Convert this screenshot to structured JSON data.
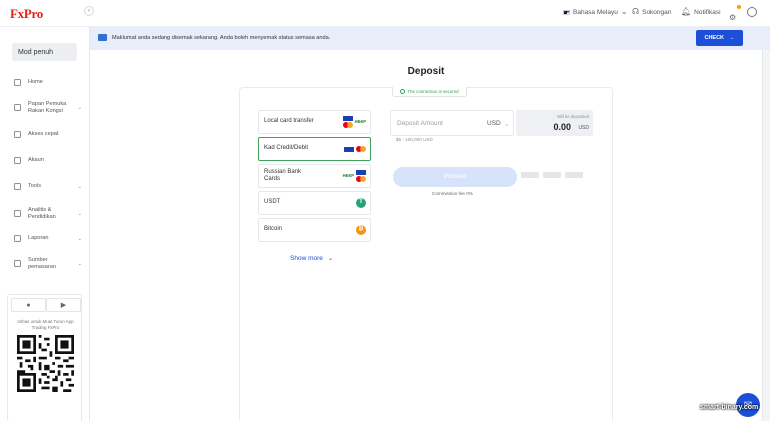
{
  "app": {
    "logo": "FxPro"
  },
  "topbar": {
    "language": "Bahasa Melayu",
    "support": "Sokongan",
    "notifications": "Notifikasi"
  },
  "sidebar": {
    "mode_button": "Mod penuh",
    "items": [
      {
        "label": "Home",
        "icon": "home-icon",
        "has_chevron": false
      },
      {
        "label": "Papan Pemuka Rakan Kongsi",
        "icon": "dashboard-icon",
        "has_chevron": true
      },
      {
        "label": "Akses cepat",
        "icon": "grid-icon",
        "has_chevron": false
      },
      {
        "label": "Akaun",
        "icon": "account-icon",
        "has_chevron": false
      },
      {
        "label": "Tools",
        "icon": "tools-icon",
        "has_chevron": true
      },
      {
        "label": "Analitis & Pendidikan",
        "icon": "education-icon",
        "has_chevron": true
      },
      {
        "label": "Laporan",
        "icon": "report-icon",
        "has_chevron": true
      },
      {
        "label": "Sumber pemasaran",
        "icon": "marketing-icon",
        "has_chevron": true
      }
    ],
    "app_promo": {
      "text": "Imbas untuk Muat Turun App Trading FxPro"
    }
  },
  "banner": {
    "message": "Maklumat anda sedang disemak sekarang. Anda boleh menyemak status semasa anda.",
    "check_button": "CHECK"
  },
  "deposit": {
    "title": "Deposit",
    "secure_text": "The connection is secured",
    "methods": [
      {
        "label": "Local card transfer",
        "active": false,
        "logos": "visa-mc-nbkp"
      },
      {
        "label": "Kad Credit/Debit",
        "active": true,
        "logos": "visa-mc"
      },
      {
        "label": "Russian Bank Cards",
        "active": false,
        "logos": "nbkp-visa-mc"
      },
      {
        "label": "USDT",
        "active": false,
        "logos": "usdt"
      },
      {
        "label": "Bitcoin",
        "active": false,
        "logos": "btc"
      }
    ],
    "show_more": "Show more",
    "amount_placeholder": "Deposit Amount",
    "currency": "USD",
    "deposited_label": "Will be deposited",
    "deposited_value": "0.00",
    "deposited_currency": "USD",
    "range": "$5 - 100,000 USD",
    "proceed_button": "Proceed",
    "commission": "Commission fee 0%"
  },
  "colors": {
    "accent": "#1c4fd8",
    "active_border": "#3aa05a",
    "logo_red": "#e2231a",
    "banner_bg": "#e8eef9"
  },
  "watermark": "smart-binary.com"
}
